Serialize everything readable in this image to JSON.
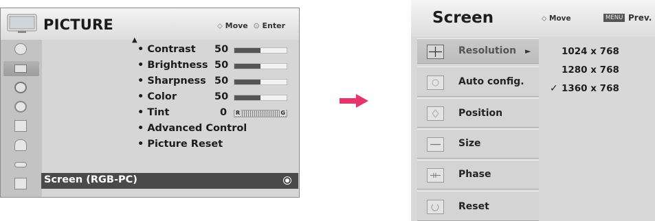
{
  "picture_menu": {
    "title": "PICTURE",
    "hint_move": "Move",
    "hint_enter": "Enter",
    "sidebar_icons": [
      "satellite-icon",
      "picture-icon",
      "audio-icon",
      "clock-icon",
      "option-icon",
      "lock-icon",
      "input-icon",
      "usb-icon"
    ],
    "rows": [
      {
        "label": "• Contrast",
        "value": "50",
        "level": 0.5
      },
      {
        "label": "• Brightness",
        "value": "50",
        "level": 0.5
      },
      {
        "label": "• Sharpness",
        "value": "50",
        "level": 0.5
      },
      {
        "label": "• Color",
        "value": "50",
        "level": 0.5
      },
      {
        "label": "• Tint",
        "value": "0",
        "r_label": "R",
        "g_label": "G"
      },
      {
        "label": "• Advanced Control"
      },
      {
        "label": "• Picture Reset"
      }
    ],
    "selected_row": "Screen (RGB-PC)"
  },
  "screen_menu": {
    "title": "Screen",
    "hint_move": "Move",
    "menu_key": "MENU",
    "hint_prev": "Prev.",
    "items": [
      {
        "label": "Resolution",
        "caret": "►"
      },
      {
        "label": "Auto config."
      },
      {
        "label": "Position"
      },
      {
        "label": "Size"
      },
      {
        "label": "Phase"
      },
      {
        "label": "Reset"
      }
    ],
    "resolutions": [
      "1024 x 768",
      "1280 x 768",
      "1360 x 768"
    ],
    "checkmark": "✓",
    "selected_resolution": "1360 x 768"
  },
  "colors": {
    "arrow": "#e8336d",
    "selected_bg": "#4a4a4a"
  }
}
